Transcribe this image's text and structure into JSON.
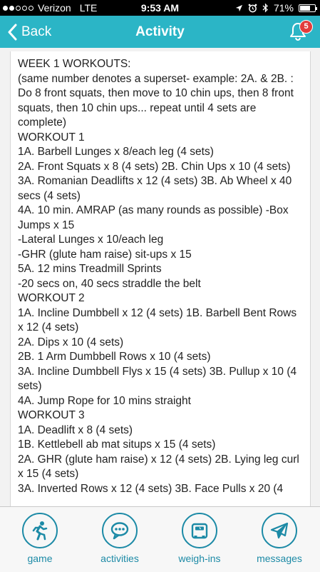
{
  "status_bar": {
    "carrier": "Verizon",
    "network": "LTE",
    "time": "9:53 AM",
    "battery": "71%",
    "battery_level": 0.71
  },
  "nav": {
    "back_label": "Back",
    "title": "Activity",
    "notification_count": "5"
  },
  "content": {
    "lines": [
      "WEEK 1 WORKOUTS:",
      "(same number denotes a superset- example: 2A. & 2B. : Do 8 front squats, then move to 10 chin ups, then 8 front squats, then 10 chin ups... repeat until 4 sets are complete)",
      "WORKOUT 1",
      "1A. Barbell Lunges x 8/each leg (4 sets)",
      "2A. Front Squats x 8 (4 sets) 2B. Chin Ups x 10 (4 sets)",
      "3A. Romanian Deadlifts x 12 (4 sets) 3B. Ab Wheel x 40 secs (4 sets)",
      "4A. 10 min. AMRAP (as many rounds as possible) -Box Jumps x 15",
      "-Lateral Lunges x 10/each leg",
      "-GHR (glute ham raise) sit-ups x 15",
      "5A. 12 mins Treadmill Sprints",
      "-20 secs on, 40 secs straddle the belt",
      "WORKOUT 2",
      "1A. Incline Dumbbell x 12 (4 sets) 1B. Barbell Bent Rows x 12 (4 sets)",
      "2A. Dips x 10 (4 sets)",
      "2B. 1 Arm Dumbbell Rows x 10 (4 sets)",
      "3A. Incline Dumbbell Flys x 15 (4 sets) 3B. Pullup x 10 (4 sets)",
      "4A. Jump Rope for 10 mins straight",
      "WORKOUT 3",
      "1A. Deadlift x 8 (4 sets)",
      "1B. Kettlebell ab mat situps x 15 (4 sets)",
      "2A. GHR (glute ham raise) x 12 (4 sets) 2B. Lying leg curl x 15 (4 sets)",
      "3A. Inverted Rows x 12 (4 sets) 3B. Face Pulls x 20 (4"
    ]
  },
  "tabs": [
    {
      "label": "game",
      "icon": "runner-icon"
    },
    {
      "label": "activities",
      "icon": "chat-bubble-icon"
    },
    {
      "label": "weigh-ins",
      "icon": "scale-icon"
    },
    {
      "label": "messages",
      "icon": "paper-plane-icon"
    }
  ],
  "colors": {
    "nav_bar": "#2bb5c6",
    "tab_accent": "#1c8aa6",
    "badge": "#e23c3c"
  }
}
